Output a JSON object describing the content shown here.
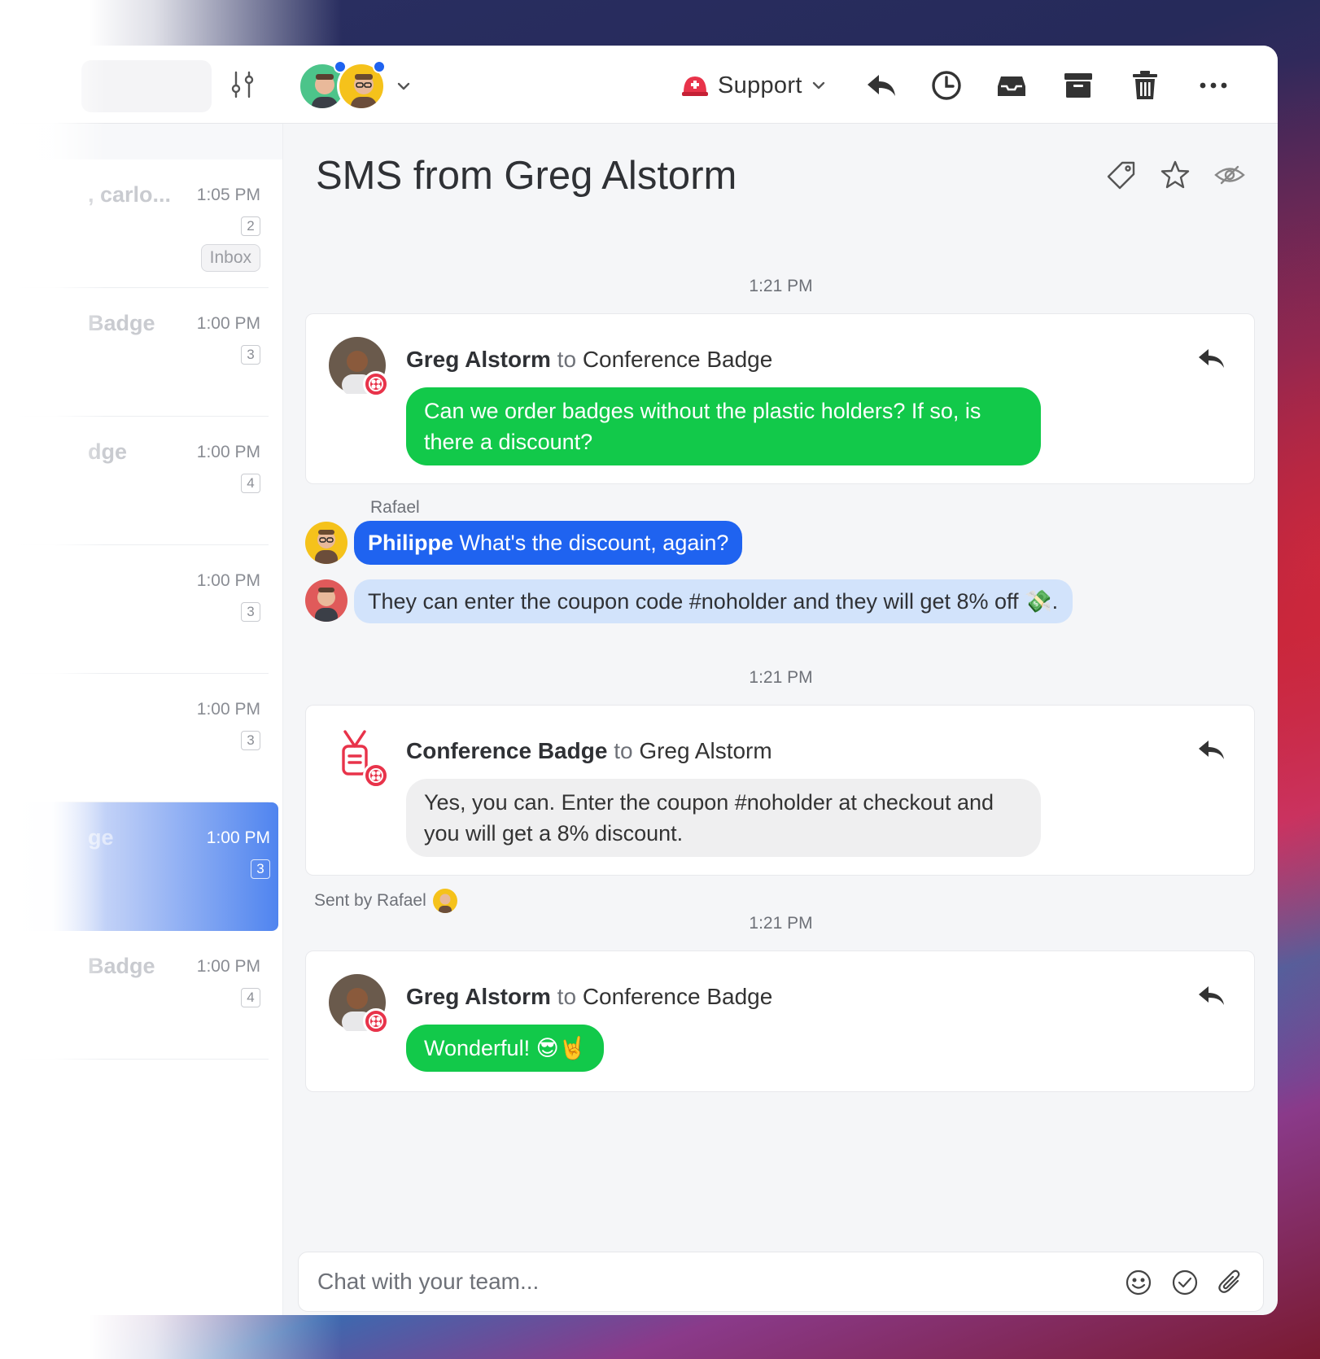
{
  "topbar": {
    "inbox_label": "Support"
  },
  "list": {
    "items": [
      {
        "name": ", carlo...",
        "time": "1:05 PM",
        "count": "2",
        "tag": "Inbox"
      },
      {
        "name": "Badge",
        "time": "1:00 PM",
        "count": "3"
      },
      {
        "name": "dge",
        "time": "1:00 PM",
        "count": "4"
      },
      {
        "name": "",
        "time": "1:00 PM",
        "count": "3"
      },
      {
        "name": "",
        "time": "1:00 PM",
        "count": "3"
      },
      {
        "name": "ge",
        "time": "1:00 PM",
        "count": "3"
      },
      {
        "name": "Badge",
        "time": "1:00 PM",
        "count": "4"
      }
    ]
  },
  "conversation": {
    "title": "SMS from Greg Alstorm",
    "messages": [
      {
        "timestamp": "1:21 PM",
        "from": "Greg Alstorm",
        "to_word": "to",
        "to": "Conference Badge",
        "text": "Can we order badges without the plastic holders? If so, is there a discount?"
      },
      {
        "timestamp": "1:21 PM",
        "from": "Conference Badge",
        "to_word": "to",
        "to": "Greg Alstorm",
        "text": "Yes, you can. Enter the coupon #noholder at checkout and you will get a 8% discount.",
        "sent_by": "Sent by Rafael"
      },
      {
        "timestamp": "1:21 PM",
        "from": "Greg Alstorm",
        "to_word": "to",
        "to": "Conference Badge",
        "text": "Wonderful! 😎🤘"
      }
    ],
    "team_chat": {
      "author": "Rafael",
      "mention": "Philippe",
      "message1": "What's the discount, again?",
      "message2": "They can enter the coupon code #noholder and they will get 8% off 💸."
    }
  },
  "composer": {
    "placeholder": "Chat with your team..."
  },
  "colors": {
    "sms_green": "#12c94a",
    "team_blue": "#1f63f0",
    "team_lightblue": "#d2e3fb",
    "twilio_red": "#e8334a"
  }
}
